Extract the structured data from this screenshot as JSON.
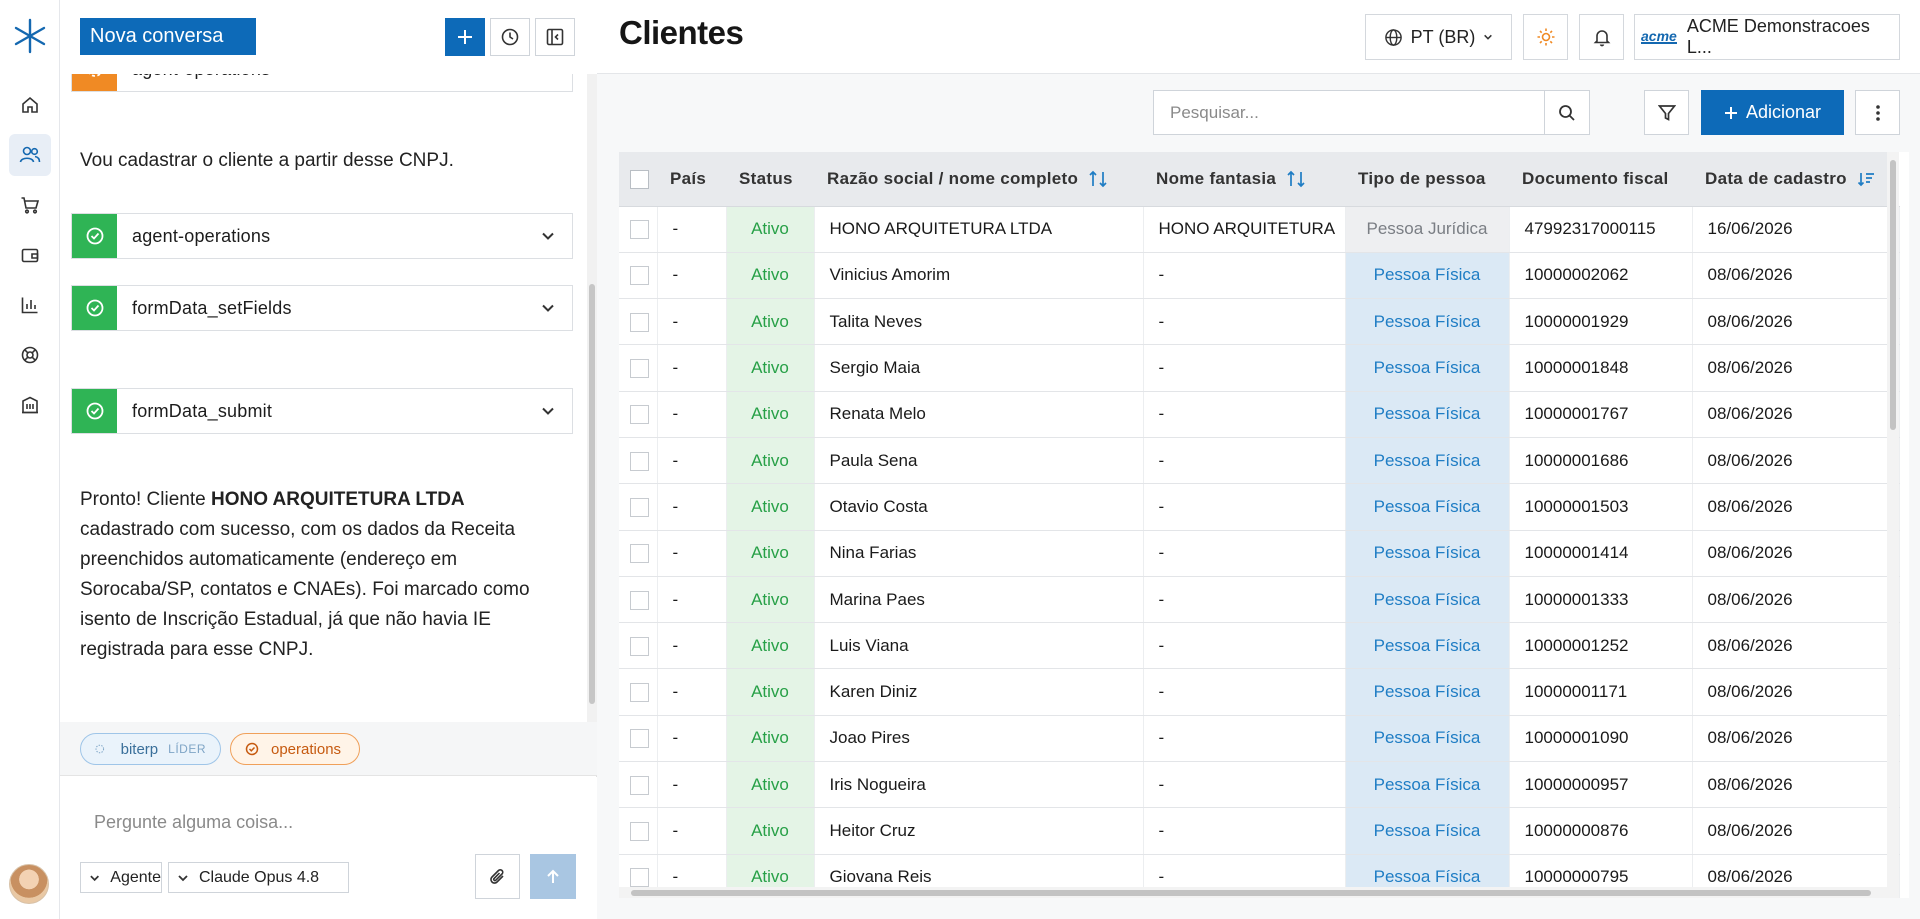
{
  "chat": {
    "new_chat_label": "Nova conversa",
    "tools": [
      {
        "name": "agent-operations",
        "status": "running"
      },
      {
        "name": "agent-operations",
        "status": "success"
      },
      {
        "name": "formData_setFields",
        "status": "success"
      },
      {
        "name": "formData_submit",
        "status": "success"
      }
    ],
    "messages": [
      {
        "text": "Vou cadastrar o cliente a partir desse CNPJ."
      },
      {
        "prefix": "Pronto! Cliente ",
        "bold": "HONO ARQUITETURA LTDA",
        "suffix": " cadastrado com sucesso, com os dados da Receita preenchidos automaticamente (endereço em Sorocaba/SP, contatos e CNAEs). Foi marcado como isento de Inscrição Estadual, já que não havia IE registrada para esse CNPJ."
      }
    ],
    "agents": [
      {
        "name": "biterp",
        "tag": "LÍDER"
      },
      {
        "name": "operations"
      }
    ],
    "composer": {
      "placeholder": "Pergunte alguma coisa...",
      "mode": "Agente",
      "model": "Claude Opus 4.8"
    }
  },
  "header": {
    "title": "Clientes",
    "language": "PT (BR)",
    "company": "ACME Demonstracoes L...",
    "company_logo_text": "acme"
  },
  "toolbar": {
    "search_placeholder": "Pesquisar...",
    "add_label": "Adicionar"
  },
  "table": {
    "columns": [
      "País",
      "Status",
      "Razão social / nome completo",
      "Nome fantasia",
      "Tipo de pessoa",
      "Documento fiscal",
      "Data de cadastro"
    ],
    "rows": [
      {
        "pais": "-",
        "status": "Ativo",
        "razao": "HONO ARQUITETURA LTDA",
        "fantasia": "HONO ARQUITETURA",
        "tipo": "Pessoa Jurídica",
        "doc": "47992317000115",
        "data": "16/06/2026"
      },
      {
        "pais": "-",
        "status": "Ativo",
        "razao": "Vinicius Amorim",
        "fantasia": "-",
        "tipo": "Pessoa Física",
        "doc": "10000002062",
        "data": "08/06/2026"
      },
      {
        "pais": "-",
        "status": "Ativo",
        "razao": "Talita Neves",
        "fantasia": "-",
        "tipo": "Pessoa Física",
        "doc": "10000001929",
        "data": "08/06/2026"
      },
      {
        "pais": "-",
        "status": "Ativo",
        "razao": "Sergio Maia",
        "fantasia": "-",
        "tipo": "Pessoa Física",
        "doc": "10000001848",
        "data": "08/06/2026"
      },
      {
        "pais": "-",
        "status": "Ativo",
        "razao": "Renata Melo",
        "fantasia": "-",
        "tipo": "Pessoa Física",
        "doc": "10000001767",
        "data": "08/06/2026"
      },
      {
        "pais": "-",
        "status": "Ativo",
        "razao": "Paula Sena",
        "fantasia": "-",
        "tipo": "Pessoa Física",
        "doc": "10000001686",
        "data": "08/06/2026"
      },
      {
        "pais": "-",
        "status": "Ativo",
        "razao": "Otavio Costa",
        "fantasia": "-",
        "tipo": "Pessoa Física",
        "doc": "10000001503",
        "data": "08/06/2026"
      },
      {
        "pais": "-",
        "status": "Ativo",
        "razao": "Nina Farias",
        "fantasia": "-",
        "tipo": "Pessoa Física",
        "doc": "10000001414",
        "data": "08/06/2026"
      },
      {
        "pais": "-",
        "status": "Ativo",
        "razao": "Marina Paes",
        "fantasia": "-",
        "tipo": "Pessoa Física",
        "doc": "10000001333",
        "data": "08/06/2026"
      },
      {
        "pais": "-",
        "status": "Ativo",
        "razao": "Luis Viana",
        "fantasia": "-",
        "tipo": "Pessoa Física",
        "doc": "10000001252",
        "data": "08/06/2026"
      },
      {
        "pais": "-",
        "status": "Ativo",
        "razao": "Karen Diniz",
        "fantasia": "-",
        "tipo": "Pessoa Física",
        "doc": "10000001171",
        "data": "08/06/2026"
      },
      {
        "pais": "-",
        "status": "Ativo",
        "razao": "Joao Pires",
        "fantasia": "-",
        "tipo": "Pessoa Física",
        "doc": "10000001090",
        "data": "08/06/2026"
      },
      {
        "pais": "-",
        "status": "Ativo",
        "razao": "Iris Nogueira",
        "fantasia": "-",
        "tipo": "Pessoa Física",
        "doc": "10000000957",
        "data": "08/06/2026"
      },
      {
        "pais": "-",
        "status": "Ativo",
        "razao": "Heitor Cruz",
        "fantasia": "-",
        "tipo": "Pessoa Física",
        "doc": "10000000876",
        "data": "08/06/2026"
      },
      {
        "pais": "-",
        "status": "Ativo",
        "razao": "Giovana Reis",
        "fantasia": "-",
        "tipo": "Pessoa Física",
        "doc": "10000000795",
        "data": "08/06/2026"
      }
    ]
  },
  "colors": {
    "primary": "#0d6ab8",
    "success": "#2fb455",
    "warning": "#f08a24",
    "status_active_bg": "#e4f4e6",
    "tipo_pf_text": "#1f7dc4"
  },
  "icons": {
    "rail": [
      "home-icon",
      "users-icon",
      "cart-icon",
      "wallet-icon",
      "chart-icon",
      "support-icon",
      "building-icon"
    ]
  }
}
